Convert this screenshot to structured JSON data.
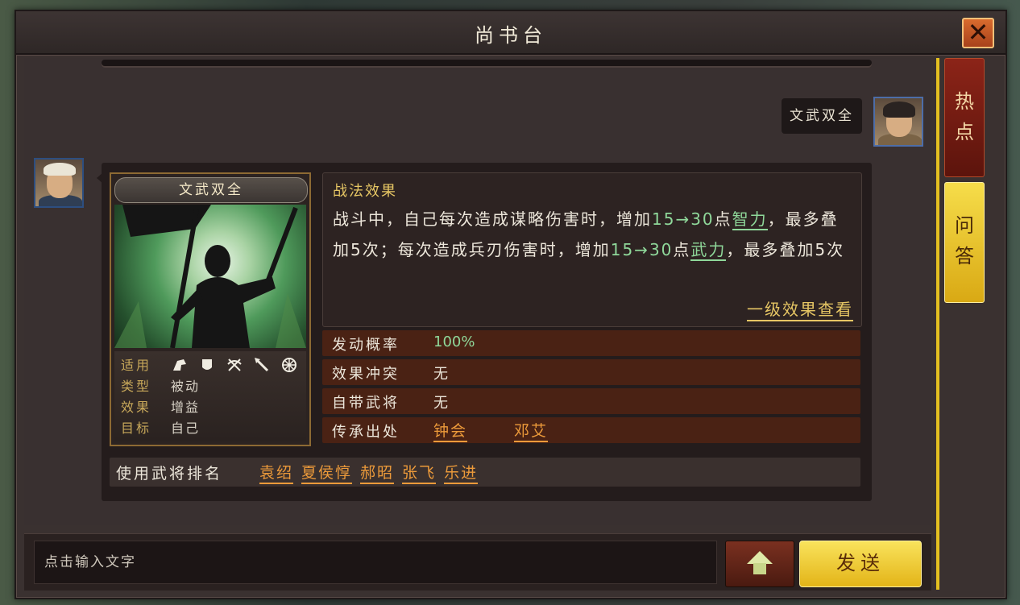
{
  "window": {
    "title": "尚书台"
  },
  "message": {
    "sent_text": "文武双全"
  },
  "skill": {
    "name": "文武双全",
    "meta": {
      "suitable_label": "适用",
      "type_label": "类型",
      "type_value": "被动",
      "effect_label": "效果",
      "effect_value": "增益",
      "target_label": "目标",
      "target_value": "自己",
      "troop_icons": [
        "cavalry-icon",
        "shield-icon",
        "bow-icon",
        "spear-icon",
        "wheel-icon"
      ]
    },
    "effect_title": "战法效果",
    "effect_parts": {
      "p1": "战斗中，自己每次造成谋略伤害时，增加",
      "n1": "15→30",
      "p2": "点",
      "link1": "智力",
      "p3": "，最多叠加5次；每次造成兵刃伤害时，增加",
      "n2": "15→30",
      "p4": "点",
      "link2": "武力",
      "p5": "，最多叠加5次"
    },
    "level_link": "一级效果查看",
    "rows": {
      "rate_label": "发动概率",
      "rate_value": "100%",
      "conflict_label": "效果冲突",
      "conflict_value": "无",
      "own_general_label": "自带武将",
      "own_general_value": "无",
      "inherit_label": "传承出处",
      "inherit_sources": [
        "钟会",
        "邓艾"
      ]
    },
    "rank_label": "使用武将排名",
    "rank_names": [
      "袁绍",
      "夏侯惇",
      "郝昭",
      "张飞",
      "乐进"
    ]
  },
  "tabs": {
    "hot": [
      "热",
      "点"
    ],
    "qa": [
      "问",
      "答"
    ]
  },
  "input": {
    "placeholder": "点击输入文字",
    "send_label": "发送"
  },
  "colors": {
    "accent_yellow": "#e6c664",
    "link_orange": "#ec9a3a",
    "value_green": "#8fd89a",
    "row_brown": "#4a2214"
  }
}
